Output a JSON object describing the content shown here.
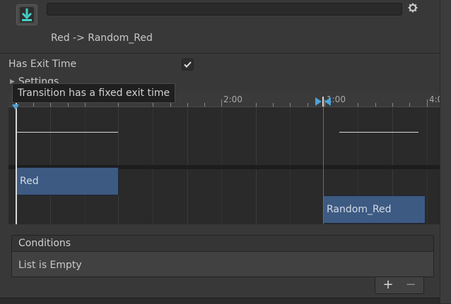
{
  "header": {
    "name_field_value": "",
    "title": "Red -> Random_Red",
    "icon": "transition-icon",
    "settings_icon": "gear-icon"
  },
  "settings": {
    "has_exit_time_label": "Has Exit Time",
    "has_exit_time_checked": true,
    "settings_label": "Settings",
    "tooltip": "Transition has a fixed exit time"
  },
  "timeline": {
    "ruler_labels": [
      "2:00",
      "1:00",
      "4:0"
    ],
    "source_state": "Red",
    "destination_state": "Random_Red"
  },
  "conditions": {
    "header": "Conditions",
    "empty_text": "List is Empty",
    "add_label": "+",
    "remove_label": "−"
  },
  "colors": {
    "accent": "#4da3d6",
    "state_bar": "#3d5a82",
    "background": "#383838"
  }
}
